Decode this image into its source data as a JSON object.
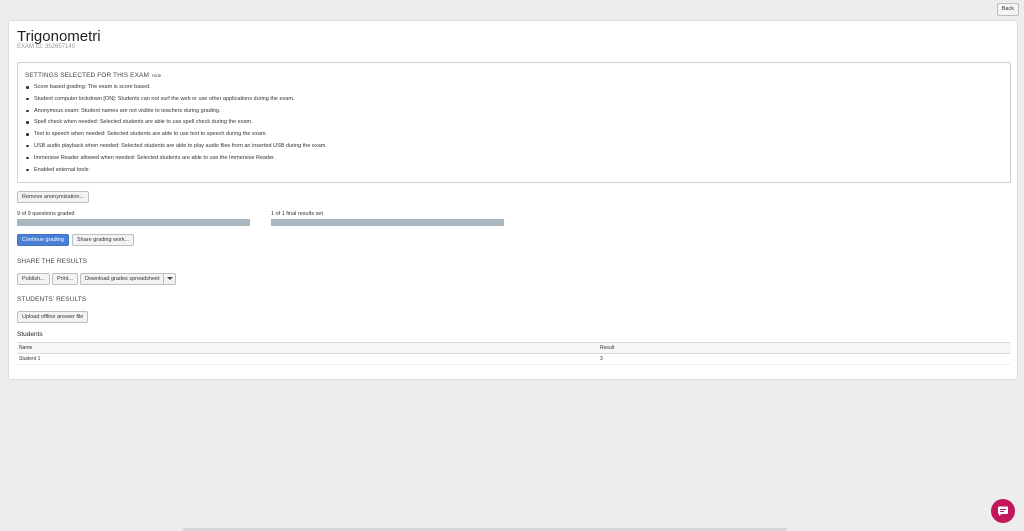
{
  "topbar": {
    "back_label": "Back"
  },
  "exam": {
    "title": "Trigonometri",
    "id_text": "EXAM ID: 352657140"
  },
  "settings": {
    "heading": "SETTINGS SELECTED FOR THIS EXAM",
    "hide_label": "Hide",
    "items": [
      "Score based grading: The exam is score based.",
      "Student computer lockdown [ON]: Students can not surf the web or use other applications during the exam.",
      "Anonymous exam: Student names are not visible to teachers during grading.",
      "Spell check when needed: Selected students are able to use spell check during the exam.",
      "Text to speech when needed: Selected students are able to use text to speech during the exam.",
      "USB audio playback when needed: Selected students are able to play audio files from an inserted USB during the exam.",
      "Immersive Reader allowed when needed: Selected students are able to use the Immersive Reader.",
      "Enabled external tools:"
    ]
  },
  "grading": {
    "remove_anon_label": "Remove anonymization...",
    "questions_graded_label": "9 of 9 questions graded",
    "questions_graded_progress": 1.0,
    "final_results_label": "1 of 1 final results set",
    "final_results_progress": 1.0,
    "continue_label": "Continue grading",
    "share_work_label": "Share grading work..."
  },
  "share": {
    "heading": "SHARE THE RESULTS",
    "publish_label": "Publish...",
    "print_label": "Print...",
    "download_label": "Download grades spreadsheet"
  },
  "students_results": {
    "heading": "STUDENTS' RESULTS",
    "upload_label": "Upload offline answer file"
  },
  "students": {
    "title": "Students",
    "columns": [
      "Name",
      "Result"
    ],
    "rows": [
      {
        "name": "Student 1",
        "result": "3"
      }
    ]
  },
  "colors": {
    "primary": "#4a7fd6",
    "chat": "#c2185b",
    "progress": "#a9b6bd"
  },
  "icons": {
    "chat": "chat-bubble-icon",
    "dropdown": "chevron-down-icon"
  }
}
